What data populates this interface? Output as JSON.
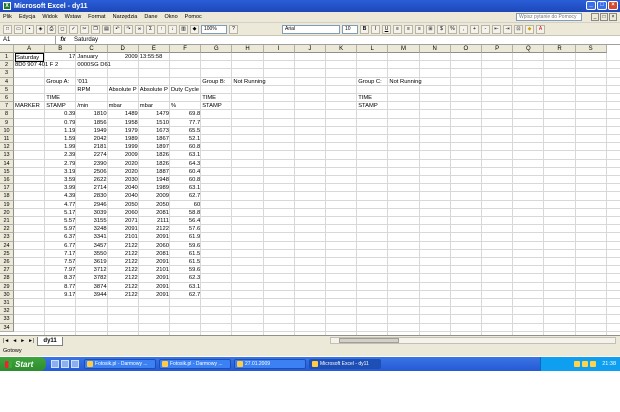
{
  "window": {
    "title": "Microsoft Excel - dy11"
  },
  "menu": [
    "Plik",
    "Edycja",
    "Widok",
    "Wstaw",
    "Format",
    "Narzędzia",
    "Dane",
    "Okno",
    "Pomoc"
  ],
  "help_placeholder": "Wpisz pytanie do Pomocy",
  "toolbar": {
    "zoom": "100%",
    "font": "Arial",
    "size": "10",
    "bold": "B",
    "italic": "I",
    "underline": "U"
  },
  "formula": {
    "name": "A1",
    "fx": "fx",
    "content": "Saturday"
  },
  "columns": [
    "A",
    "B",
    "C",
    "D",
    "E",
    "F",
    "G",
    "H",
    "I",
    "J",
    "K",
    "L",
    "M",
    "N",
    "O",
    "P",
    "Q",
    "R",
    "S"
  ],
  "rows": [
    "1",
    "2",
    "3",
    "4",
    "5",
    "6",
    "7",
    "8",
    "9",
    "10",
    "11",
    "12",
    "13",
    "14",
    "15",
    "16",
    "17",
    "18",
    "19",
    "20",
    "21",
    "22",
    "23",
    "24",
    "25",
    "26",
    "27",
    "28",
    "29",
    "30",
    "31",
    "32",
    "33",
    "34"
  ],
  "header_cells": {
    "r1": {
      "A": "Saturday",
      "B": "17",
      "C": "January",
      "D": "2009",
      "E": "13:55:58"
    },
    "r2": {
      "A": "8D0 907 401 F 2",
      "C": "0000SG  D61"
    },
    "r4": {
      "B": "Group A:",
      "C": "'011",
      "G": "Group B:",
      "H": "Not Running",
      "L": "Group C:",
      "M": "Not Running"
    },
    "r5": {
      "C": "RPM",
      "D": "Absolute P",
      "E": "Absolute P",
      "F": "Duty Cycle"
    },
    "r6": {
      "B": "TIME",
      "G": "TIME",
      "L": "TIME"
    },
    "r7": {
      "A": "MARKER",
      "B": "STAMP",
      "C": "/min",
      "D": "mbar",
      "E": "mbar",
      "F": "%",
      "G": "STAMP",
      "L": "STAMP"
    }
  },
  "table": [
    [
      "0.39",
      "1810",
      "1489",
      "1479",
      "69.8"
    ],
    [
      "0.79",
      "1856",
      "1958",
      "1510",
      "77.7"
    ],
    [
      "1.19",
      "1949",
      "1979",
      "1673",
      "65.5"
    ],
    [
      "1.59",
      "2042",
      "1989",
      "1867",
      "52.1"
    ],
    [
      "1.99",
      "2181",
      "1999",
      "1897",
      "60.8"
    ],
    [
      "2.39",
      "2274",
      "2009",
      "1826",
      "63.1"
    ],
    [
      "2.79",
      "2390",
      "2020",
      "1826",
      "64.3"
    ],
    [
      "3.19",
      "2506",
      "2020",
      "1887",
      "60.4"
    ],
    [
      "3.59",
      "2622",
      "2030",
      "1948",
      "60.8"
    ],
    [
      "3.99",
      "2714",
      "2040",
      "1989",
      "63.1"
    ],
    [
      "4.39",
      "2830",
      "2040",
      "2009",
      "62.7"
    ],
    [
      "4.77",
      "2946",
      "2050",
      "2050",
      "60"
    ],
    [
      "5.17",
      "3039",
      "2060",
      "2081",
      "58.8"
    ],
    [
      "5.57",
      "3155",
      "2071",
      "2111",
      "56.4"
    ],
    [
      "5.97",
      "3248",
      "2091",
      "2122",
      "57.6"
    ],
    [
      "6.37",
      "3341",
      "2101",
      "2091",
      "61.9"
    ],
    [
      "6.77",
      "3457",
      "2122",
      "2060",
      "59.6"
    ],
    [
      "7.17",
      "3550",
      "2122",
      "2081",
      "61.5"
    ],
    [
      "7.57",
      "3619",
      "2122",
      "2091",
      "61.5"
    ],
    [
      "7.97",
      "3712",
      "2122",
      "2101",
      "59.6"
    ],
    [
      "8.37",
      "3782",
      "2122",
      "2091",
      "62.3"
    ],
    [
      "8.77",
      "3874",
      "2122",
      "2091",
      "63.1"
    ],
    [
      "9.17",
      "3944",
      "2122",
      "2091",
      "62.7"
    ]
  ],
  "sheet_tab": "dy11",
  "status": "Gotowy",
  "taskbar": {
    "start": "Start",
    "tasks": [
      "Fotosik.pl - Darmowy ...",
      "Fotosik.pl - Darmowy ...",
      "27.01.2009",
      "Microsoft Excel - dy11"
    ],
    "clock": "21:38"
  }
}
